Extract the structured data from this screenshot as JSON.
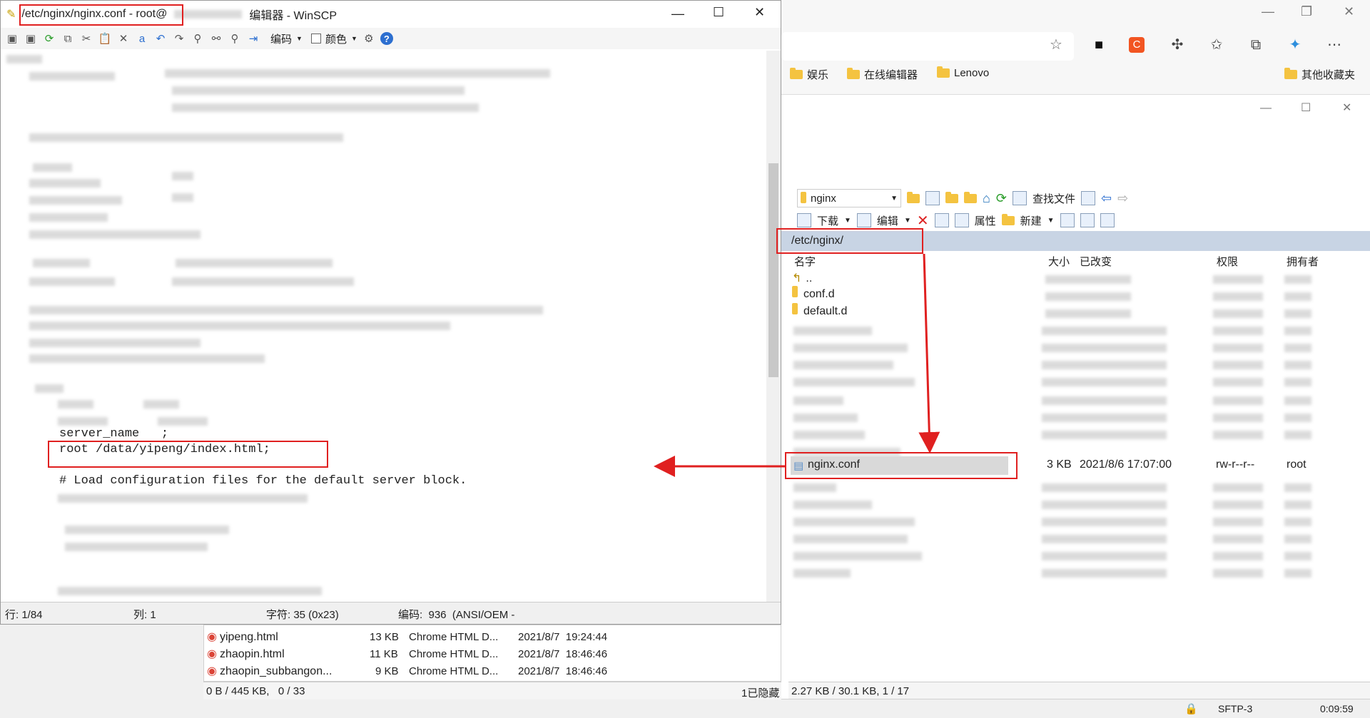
{
  "editor": {
    "title_path": "/etc/nginx/nginx.conf - root@",
    "title_rest": "编辑器 - WinSCP",
    "toolbar": {
      "encoding_label": "编码",
      "color_label": "颜色"
    },
    "code": {
      "server_name_line": "server_name   ;",
      "root_line": "root /data/yipeng/index.html;",
      "comment_line": "# Load configuration files for the default server block."
    },
    "status": {
      "line": "行: 1/84",
      "col": "列: 1",
      "char": "字符: 35 (0x23)",
      "encoding": "编码:  936  (ANSI/OEM -"
    }
  },
  "browser": {
    "bookmarks": [
      "娱乐",
      "在线编辑器",
      "Lenovo"
    ],
    "other_bookmarks": "其他收藏夹"
  },
  "remote": {
    "dir_dropdown": "nginx",
    "find_files": "查找文件",
    "download": "下载",
    "edit": "编辑",
    "properties": "属性",
    "new": "新建",
    "path": "/etc/nginx/",
    "columns": {
      "name": "名字",
      "size": "大小",
      "changed": "已改变",
      "rights": "权限",
      "owner": "拥有者"
    },
    "files": [
      {
        "name": ".."
      },
      {
        "name": "conf.d"
      },
      {
        "name": "default.d"
      }
    ],
    "selected": {
      "name": "nginx.conf",
      "size": "3 KB",
      "changed": "2021/8/6 17:07:00",
      "rights": "rw-r--r--",
      "owner": "root"
    },
    "status": "2.27 KB / 30.1 KB,    1 / 17",
    "protocol": "SFTP-3",
    "timer": "0:09:59"
  },
  "local": {
    "files": [
      {
        "name": "yipeng.html",
        "size": "13 KB",
        "type": "Chrome HTML D...",
        "changed": "2021/8/7  19:24:44"
      },
      {
        "name": "zhaopin.html",
        "size": "11 KB",
        "type": "Chrome HTML D...",
        "changed": "2021/8/7  18:46:46"
      },
      {
        "name": "zhaopin_subbangon...",
        "size": "9 KB",
        "type": "Chrome HTML D...",
        "changed": "2021/8/7  18:46:46"
      }
    ],
    "status": "0 B / 445 KB,   0 / 33",
    "hidden": "1已隐藏"
  },
  "colors": {
    "accent": "#e02020",
    "selection": "#d9d9d9",
    "path_bar": "#c8d4e4"
  }
}
